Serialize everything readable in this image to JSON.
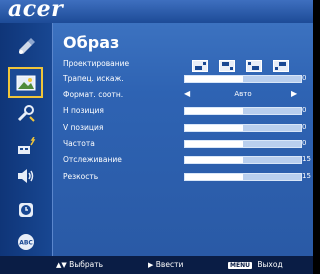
{
  "brand": {
    "logo_text": "acer"
  },
  "sidebar": {
    "items": [
      {
        "icon": "color-management-icon"
      },
      {
        "icon": "image-icon"
      },
      {
        "icon": "setup-wrench-icon"
      },
      {
        "icon": "management-icon"
      },
      {
        "icon": "audio-speaker-icon"
      },
      {
        "icon": "timer-icon"
      },
      {
        "icon": "language-abc-icon"
      }
    ],
    "active_index": 1
  },
  "panel": {
    "title": "Образ",
    "rows": [
      {
        "label": "Проектирование",
        "type": "icons"
      },
      {
        "label": "Трапец. искаж.",
        "type": "slider",
        "level": 0.5,
        "value": "0"
      },
      {
        "label": "Формат. соотн.",
        "type": "select",
        "value": "Авто"
      },
      {
        "label": "Н позиция",
        "type": "slider",
        "level": 0.5,
        "value": "0"
      },
      {
        "label": "V позиция",
        "type": "slider",
        "level": 0.5,
        "value": "0"
      },
      {
        "label": "Частота",
        "type": "slider",
        "level": 0.5,
        "value": "0"
      },
      {
        "label": "Отслеживание",
        "type": "slider",
        "level": 0.5,
        "value": "15"
      },
      {
        "label": "Резкость",
        "type": "slider",
        "level": 0.5,
        "value": "15"
      }
    ],
    "projection_icons": [
      "front-desktop-icon",
      "front-ceiling-icon",
      "rear-desktop-icon",
      "rear-ceiling-icon"
    ]
  },
  "footer": {
    "select_label": "Выбрать",
    "enter_label": "Ввести",
    "menu_key": "MENU",
    "exit_label": "Выход"
  },
  "colors": {
    "panel_bg": "#2e63b3",
    "sidebar_bg": "#184792",
    "highlight": "#f0c53a"
  }
}
